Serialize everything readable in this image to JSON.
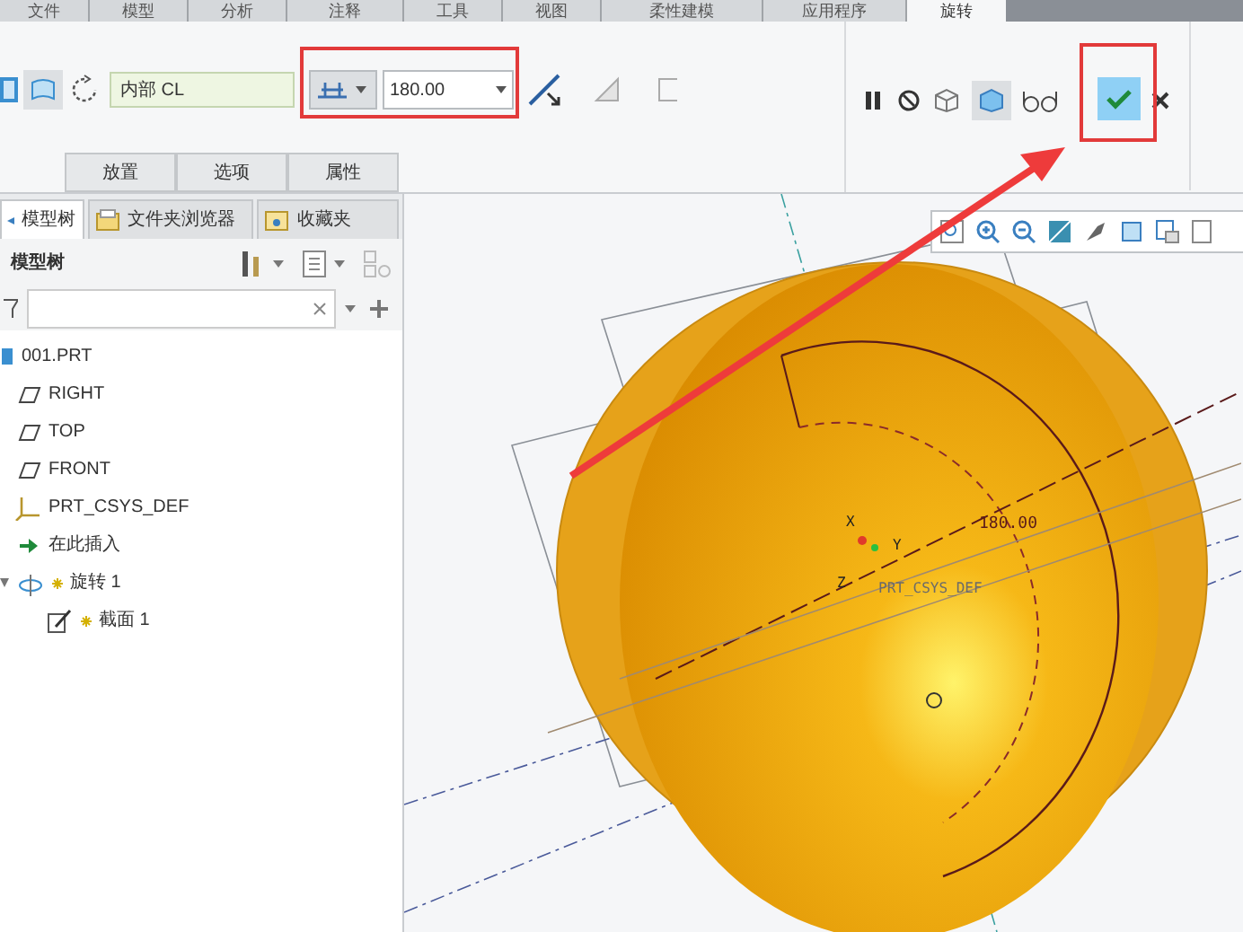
{
  "menu_tabs": [
    {
      "label": "文件",
      "selected": false
    },
    {
      "label": "模型",
      "selected": false
    },
    {
      "label": "分析",
      "selected": false
    },
    {
      "label": "注释",
      "selected": false
    },
    {
      "label": "工具",
      "selected": false
    },
    {
      "label": "视图",
      "selected": false
    },
    {
      "label": "柔性建模",
      "selected": false
    },
    {
      "label": "应用程序",
      "selected": false
    },
    {
      "label": "旋转",
      "selected": true
    }
  ],
  "dashboard": {
    "axis_field": "内部 CL",
    "angle_field": "180.00",
    "panel_buttons": [
      "放置",
      "选项",
      "属性"
    ]
  },
  "tree_tabs": [
    {
      "label": "模型树",
      "selected": true
    },
    {
      "label": "文件夹浏览器",
      "selected": false
    },
    {
      "label": "收藏夹",
      "selected": false
    }
  ],
  "tree_header": "模型树",
  "tree": [
    {
      "label": "001.PRT",
      "kind": "part",
      "new": false,
      "children": [
        {
          "label": "RIGHT",
          "kind": "plane",
          "new": false
        },
        {
          "label": "TOP",
          "kind": "plane",
          "new": false
        },
        {
          "label": "FRONT",
          "kind": "plane",
          "new": false
        },
        {
          "label": "PRT_CSYS_DEF",
          "kind": "csys",
          "new": false
        },
        {
          "label": "在此插入",
          "kind": "insert",
          "new": false
        },
        {
          "label": "旋转 1",
          "kind": "revolve",
          "new": true,
          "expanded": true,
          "children": [
            {
              "label": "截面 1",
              "kind": "sketch",
              "new": true
            }
          ]
        }
      ]
    }
  ],
  "viewport": {
    "dimension": "180.00",
    "csys_label": "PRT_CSYS_DEF",
    "axis_labels": [
      "X",
      "Y",
      "Z"
    ]
  }
}
